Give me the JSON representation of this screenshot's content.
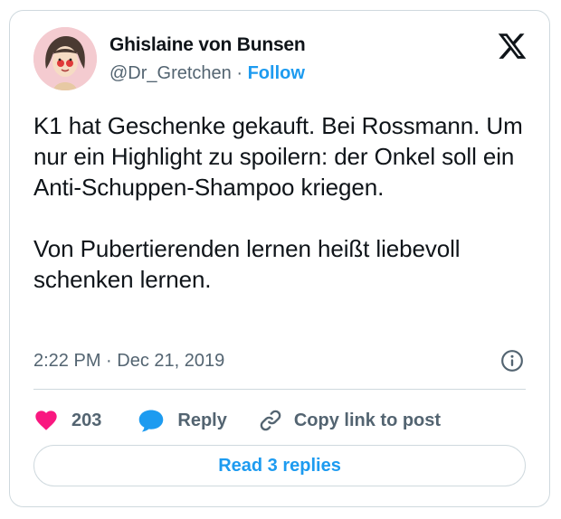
{
  "tweet": {
    "author": {
      "display_name": "Ghislaine von Bunsen",
      "handle": "@Dr_Gretchen",
      "separator": " · ",
      "follow_label": "Follow"
    },
    "text": "K1 hat Geschenke gekauft. Bei Rossmann. Um nur ein Highlight zu spoilern: der Onkel soll ein Anti-Schuppen-Shampoo kriegen.\n\nVon Pubertierenden lernen heißt liebevoll schenken lernen.",
    "timestamp": "2:22 PM · Dec 21, 2019",
    "actions": {
      "like_count": "203",
      "reply_label": "Reply",
      "copy_link_label": "Copy link to post"
    },
    "read_replies_label": "Read 3 replies"
  },
  "icons": {
    "brand": "x-logo-icon",
    "info": "info-icon",
    "like": "heart-icon",
    "reply": "speech-bubble-icon",
    "copy": "link-icon"
  },
  "colors": {
    "accent": "#1d9bf0",
    "like": "#f91880",
    "text": "#0f1419",
    "muted": "#536471",
    "border": "#cfd9de"
  }
}
